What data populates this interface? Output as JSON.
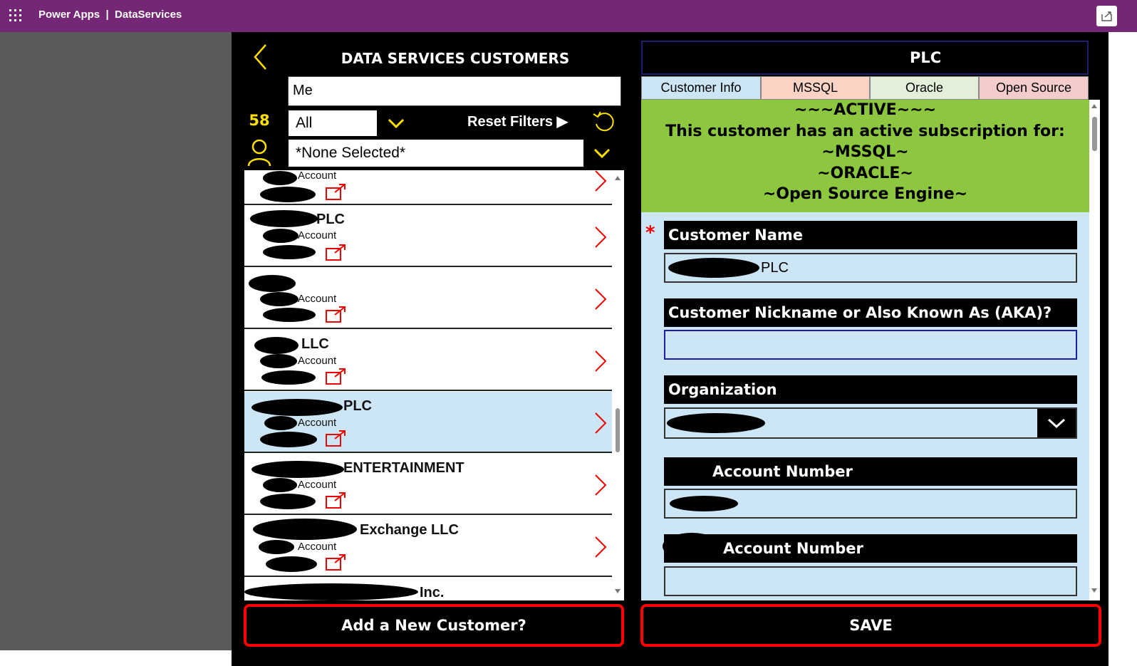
{
  "topbar": {
    "product": "Power Apps",
    "separator": "|",
    "environment": "DataServices"
  },
  "left": {
    "title": "DATA SERVICES CUSTOMERS",
    "search_value": "Me",
    "count": "58",
    "status_filter": "All",
    "reset_label": "Reset Filters ▶",
    "owner_filter": "*None Selected*",
    "rows": [
      {
        "name": "",
        "account": "Account",
        "selected": false
      },
      {
        "name": "PLC",
        "account": "Account",
        "selected": false
      },
      {
        "name": "",
        "account": "Account",
        "selected": false
      },
      {
        "name": "LLC",
        "account": "Account",
        "selected": false
      },
      {
        "name": "PLC",
        "account": "Account",
        "selected": true
      },
      {
        "name": "ENTERTAINMENT",
        "account": "Account",
        "selected": false
      },
      {
        "name": "Exchange LLC",
        "account": "Account",
        "selected": false
      },
      {
        "name": "Inc.",
        "account": "",
        "selected": false
      }
    ],
    "add_button": "Add a New Customer?"
  },
  "right": {
    "header_title": "PLC",
    "tabs": [
      {
        "label": "Customer Info",
        "color": "#cde6f5"
      },
      {
        "label": "MSSQL",
        "color": "#fad3c4"
      },
      {
        "label": "Oracle",
        "color": "#e2f0d9"
      },
      {
        "label": "Open Source",
        "color": "#f4cccc"
      }
    ],
    "banner_lines": [
      "~~~ACTIVE~~~",
      "This customer has an active subscription for:",
      "~MSSQL~",
      "~ORACLE~",
      "~Open Source Engine~"
    ],
    "banner_color": "#8dc63f",
    "required_marker": "*",
    "fields": {
      "customer_name_label": "Customer Name",
      "customer_name_value": "PLC",
      "aka_label": "Customer Nickname or Also Known As (AKA)?",
      "aka_value": "",
      "organization_label": "Organization",
      "account_number_label_1": "Account Number",
      "account_number_label_2": "Account Number"
    },
    "save_button": "SAVE"
  },
  "colors": {
    "brand": "#742774",
    "accent_yellow": "#ffe000",
    "alert_red": "#ff0000",
    "selected_row": "#cde6f5"
  }
}
